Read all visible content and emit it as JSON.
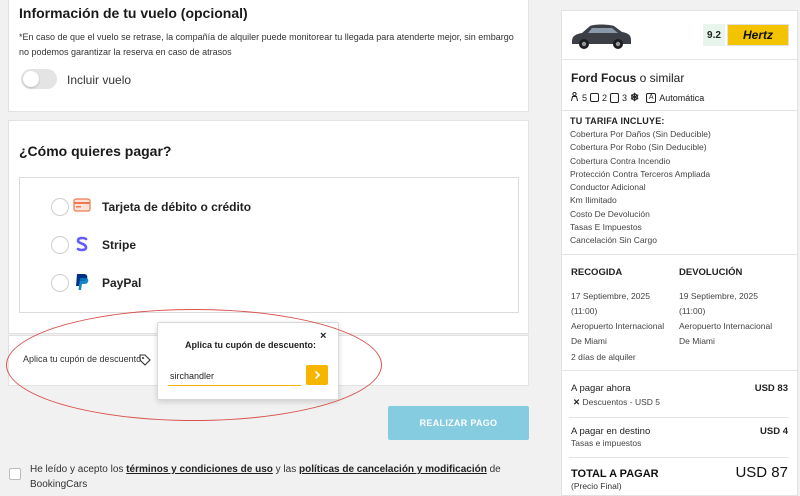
{
  "flight": {
    "title": "Información de tu vuelo (opcional)",
    "note": "*En caso de que el vuelo se retrase, la compañía de alquiler puede monitorear tu llegada para atenderte mejor, sin embargo no podemos garantizar la reserva en caso de atrasos",
    "toggle_label": "Incluir vuelo",
    "toggle_on": false
  },
  "payment": {
    "title": "¿Cómo quieres pagar?",
    "methods": [
      {
        "label": "Tarjeta de débito o crédito",
        "icon": "credit-card-icon"
      },
      {
        "label": "Stripe",
        "icon": "stripe-icon"
      },
      {
        "label": "PayPal",
        "icon": "paypal-icon"
      }
    ]
  },
  "coupon": {
    "link_text": "Aplica tu cupón de descuento",
    "popup_title": "Aplica tu cupón de descuento:",
    "input_value": "sirchandler",
    "close": "×"
  },
  "submit_label": "REALIZAR PAGO",
  "terms": {
    "prefix": "He leído y acepto los",
    "link1": "términos y condiciones de uso",
    "middle": " y las ",
    "link2": "políticas de cancelación y modificación",
    "suffix_a": " de",
    "suffix_b": "BookingCars"
  },
  "summary": {
    "rating": "9.2",
    "brand": "Hertz",
    "car_name": "Ford Focus",
    "car_suffix": " o similar",
    "specs": {
      "seats": "5",
      "doors": "2",
      "bags": "3",
      "transmission": "Automática"
    },
    "includes_title": "TU TARIFA INCLUYE:",
    "includes": [
      "Cobertura Por Daños (Sin Deducible)",
      "Cobertura Por Robo (Sin Deducible)",
      "Cobertura Contra Incendio",
      "Protección Contra Terceros Ampliada",
      "Conductor Adicional",
      "Km Ilimitado",
      "Costo De Devolución",
      "Tasas E Impuestos",
      "Cancelación Sin Cargo"
    ],
    "pickup": {
      "label": "RECOGIDA",
      "date": "17 Septiembre, 2025",
      "time": "(11:00)",
      "place1": "Aeropuerto Internacional",
      "place2": "De Miami"
    },
    "dropoff": {
      "label": "DEVOLUCIÓN",
      "date": "19 Septiembre, 2025",
      "time": "(11:00)",
      "place1": "Aeropuerto Internacional",
      "place2": "De Miami"
    },
    "rental_days": "2 días de alquiler",
    "pay_now_label": "A pagar ahora",
    "pay_now_value": "USD 83",
    "discounts": "Descuentos - USD 5",
    "pay_dest_label": "A pagar en destino",
    "pay_dest_value": "USD 4",
    "pay_dest_sub": "Tasas e impuestos",
    "total_label": "TOTAL A PAGAR",
    "total_sub": "(Precio Final)",
    "total_value": "USD 87"
  },
  "colors": {
    "accent": "#f7b500",
    "submit": "#86cce1",
    "annotation": "#d9534f",
    "stripe": "#635bff",
    "paypal": "#003087"
  }
}
